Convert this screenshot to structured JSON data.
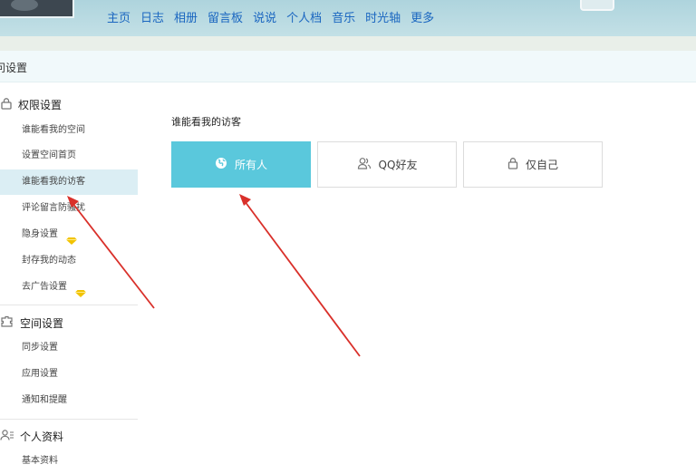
{
  "nav": {
    "items": [
      "主页",
      "日志",
      "相册",
      "留言板",
      "说说",
      "个人档",
      "音乐",
      "时光轴",
      "更多"
    ]
  },
  "page_title": "问设置",
  "sidebar": {
    "sections": [
      {
        "title": "权限设置",
        "icon": "lock-icon",
        "items": [
          {
            "label": "谁能看我的空间"
          },
          {
            "label": "设置空间首页"
          },
          {
            "label": "谁能看我的访客",
            "active": true
          },
          {
            "label": "评论留言防骚扰"
          },
          {
            "label": "隐身设置",
            "badge": "vip-diamond-icon"
          },
          {
            "label": "封存我的动态"
          },
          {
            "label": "去广告设置",
            "badge": "vip-diamond-icon"
          }
        ]
      },
      {
        "title": "空间设置",
        "icon": "puzzle-icon",
        "items": [
          {
            "label": "同步设置"
          },
          {
            "label": "应用设置"
          },
          {
            "label": "通知和提醒"
          }
        ]
      },
      {
        "title": "个人资料",
        "icon": "profile-icon",
        "items": [
          {
            "label": "基本资料"
          }
        ]
      }
    ]
  },
  "main": {
    "heading": "谁能看我的访客",
    "options": [
      {
        "label": "所有人",
        "icon": "globe-icon",
        "selected": true
      },
      {
        "label": "QQ好友",
        "icon": "friends-icon",
        "selected": false
      },
      {
        "label": "仅自己",
        "icon": "lock-icon",
        "selected": false
      }
    ]
  },
  "colors": {
    "selected": "#5ac8dc",
    "nav_link": "#1a66c0",
    "annotation_arrow": "#d9302a",
    "vip_badge": "#f2c300"
  }
}
